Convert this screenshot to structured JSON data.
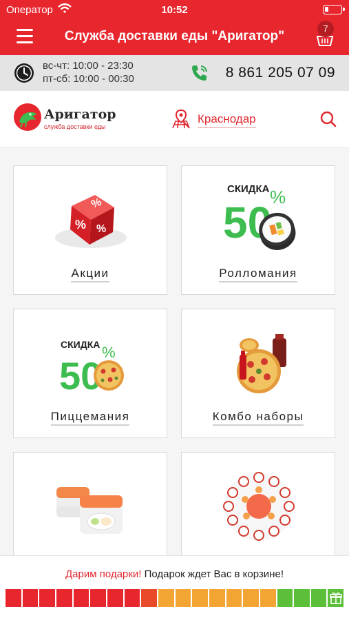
{
  "status_bar": {
    "carrier": "Оператор",
    "time": "10:52"
  },
  "nav": {
    "title": "Служба доставки еды \"Аригатор\"",
    "cart_count": "7"
  },
  "info": {
    "hours_weekdays": "вс-чт: 10:00 - 23:30",
    "hours_weekend": "пт-сб: 10:00 - 00:30",
    "phone": "8 861 205 07 09"
  },
  "brand": {
    "name": "Аригатор",
    "tagline": "служба доставки еды",
    "city": "Краснодар"
  },
  "categories": [
    {
      "label": "Акции",
      "art": "promo-dice"
    },
    {
      "label": "Ролломания",
      "art": "sale-rolls",
      "badge_text": "СКИДКА",
      "badge_value": "50",
      "badge_unit": "%"
    },
    {
      "label": "Пиццемания",
      "art": "sale-pizza",
      "badge_text": "СКИДКА",
      "badge_value": "50",
      "badge_unit": "%"
    },
    {
      "label": "Комбо наборы",
      "art": "combo"
    },
    {
      "label": "",
      "art": "roll-slices"
    },
    {
      "label": "",
      "art": "sushi-set"
    }
  ],
  "gift_bar": {
    "accent_text": "Дарим подарки!",
    "text": "Подарок ждет Вас в корзине!",
    "segments_total": 20,
    "segment_colors": [
      "#e8262e",
      "#e8262e",
      "#e8262e",
      "#e8262e",
      "#e8262e",
      "#e8262e",
      "#e8262e",
      "#e8262e",
      "#e94a2a",
      "#f3a533",
      "#f3a533",
      "#f3a533",
      "#f3a533",
      "#f3a533",
      "#f3a533",
      "#f3a533",
      "#5bbf3a",
      "#5bbf3a",
      "#5bbf3a",
      "#5bbf3a"
    ],
    "colors": {
      "red": "#e8262e",
      "orange": "#f3a533",
      "green": "#5bbf3a"
    }
  },
  "colors": {
    "brand_red": "#e8262e",
    "sale_green": "#3dbd4f"
  }
}
